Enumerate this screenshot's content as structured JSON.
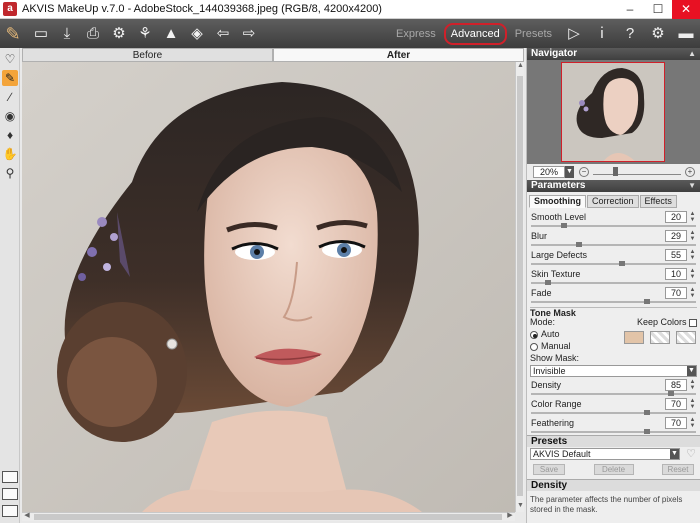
{
  "window": {
    "logo_text": "a",
    "title": "AKVIS MakeUp v.7.0 - AdobeStock_144039368.jpeg (RGB/8, 4200x4200)",
    "minimize": "–",
    "maximize": "☐",
    "close": "✕"
  },
  "toolbar": {
    "logo_glyph": "✎",
    "icons": [
      "open-icon",
      "save-icon",
      "print-icon",
      "plugins-icon",
      "batch-icon",
      "triangle-icon",
      "share-icon",
      "undo-icon",
      "redo-icon"
    ],
    "modes": [
      "Express",
      "Advanced",
      "Presets"
    ],
    "active_mode": "Advanced",
    "right_icons": [
      "run-icon",
      "info-icon",
      "help-icon",
      "settings-icon",
      "chat-icon"
    ]
  },
  "canvas": {
    "tabs": [
      "Before",
      "After"
    ],
    "active_tab": "After"
  },
  "navigator": {
    "title": "Navigator",
    "zoom": "20%"
  },
  "parameters": {
    "title": "Parameters",
    "tabs": [
      "Smoothing",
      "Correction",
      "Effects"
    ],
    "active_tab": "Smoothing",
    "sliders": [
      {
        "label": "Smooth Level",
        "value": "20",
        "fraction": 0.2
      },
      {
        "label": "Blur",
        "value": "29",
        "fraction": 0.29
      },
      {
        "label": "Large Defects",
        "value": "55",
        "fraction": 0.55
      },
      {
        "label": "Skin Texture",
        "value": "10",
        "fraction": 0.1
      },
      {
        "label": "Fade",
        "value": "70",
        "fraction": 0.7
      }
    ]
  },
  "tone_mask": {
    "title": "Tone Mask",
    "mode_label": "Mode:",
    "keep_colors_label": "Keep Colors",
    "auto_label": "Auto",
    "manual_label": "Manual",
    "selected_mode": "Auto",
    "swatch_color": "#e2c4a8",
    "show_mask_label": "Show Mask:",
    "show_mask_value": "Invisible",
    "sliders": [
      {
        "label": "Density",
        "value": "85",
        "fraction": 0.85
      },
      {
        "label": "Color Range",
        "value": "70",
        "fraction": 0.7
      },
      {
        "label": "Feathering",
        "value": "70",
        "fraction": 0.7
      }
    ]
  },
  "presets": {
    "title": "Presets",
    "selected": "AKVIS Default",
    "save": "Save",
    "delete": "Delete",
    "reset": "Reset"
  },
  "help": {
    "title": "Density",
    "text": "The parameter affects the number of pixels stored in the mask."
  },
  "colors": {
    "accent": "#d0202a",
    "slider_active": "#f3a43a"
  }
}
